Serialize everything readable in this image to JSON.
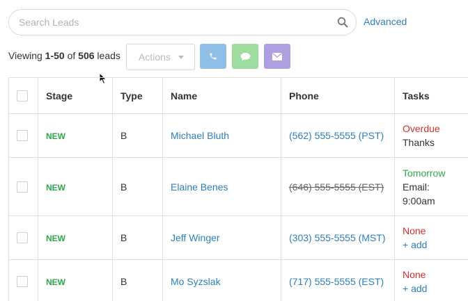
{
  "search": {
    "placeholder": "Search Leads",
    "advanced_label": "Advanced"
  },
  "summary": {
    "prefix": "Viewing",
    "range": "1-50",
    "of": "of",
    "total": "506",
    "suffix": "leads"
  },
  "toolbar": {
    "actions_label": "Actions"
  },
  "colors": {
    "phone": "#8fbfe6",
    "sms": "#9fdc9f",
    "email": "#b09fe0",
    "link": "#2c7fb8",
    "stage_new": "#2ea84a",
    "overdue": "#d0302a"
  },
  "table": {
    "headers": {
      "stage": "Stage",
      "type": "Type",
      "name": "Name",
      "phone": "Phone",
      "tasks": "Tasks"
    },
    "rows": [
      {
        "stage": "NEW",
        "type": "B",
        "name": "Michael Bluth",
        "phone": "(562) 555-5555 (PST)",
        "task_status": "Overdue",
        "task_desc": "Thanks"
      },
      {
        "stage": "NEW",
        "type": "B",
        "name": "Elaine Benes",
        "phone": "(646) 555-5555 (EST)",
        "task_status": "Tomorrow",
        "task_desc": "Email:",
        "task_time": "9:00am"
      },
      {
        "stage": "NEW",
        "type": "B",
        "name": "Jeff Winger",
        "phone": "(303) 555-5555 (MST)",
        "task_status": "None",
        "task_add": "+ add"
      },
      {
        "stage": "NEW",
        "type": "B",
        "name": "Mo Syzslak",
        "phone": "(717) 555-5555 (EST)",
        "task_status": "None",
        "task_add": "+ add"
      }
    ]
  }
}
